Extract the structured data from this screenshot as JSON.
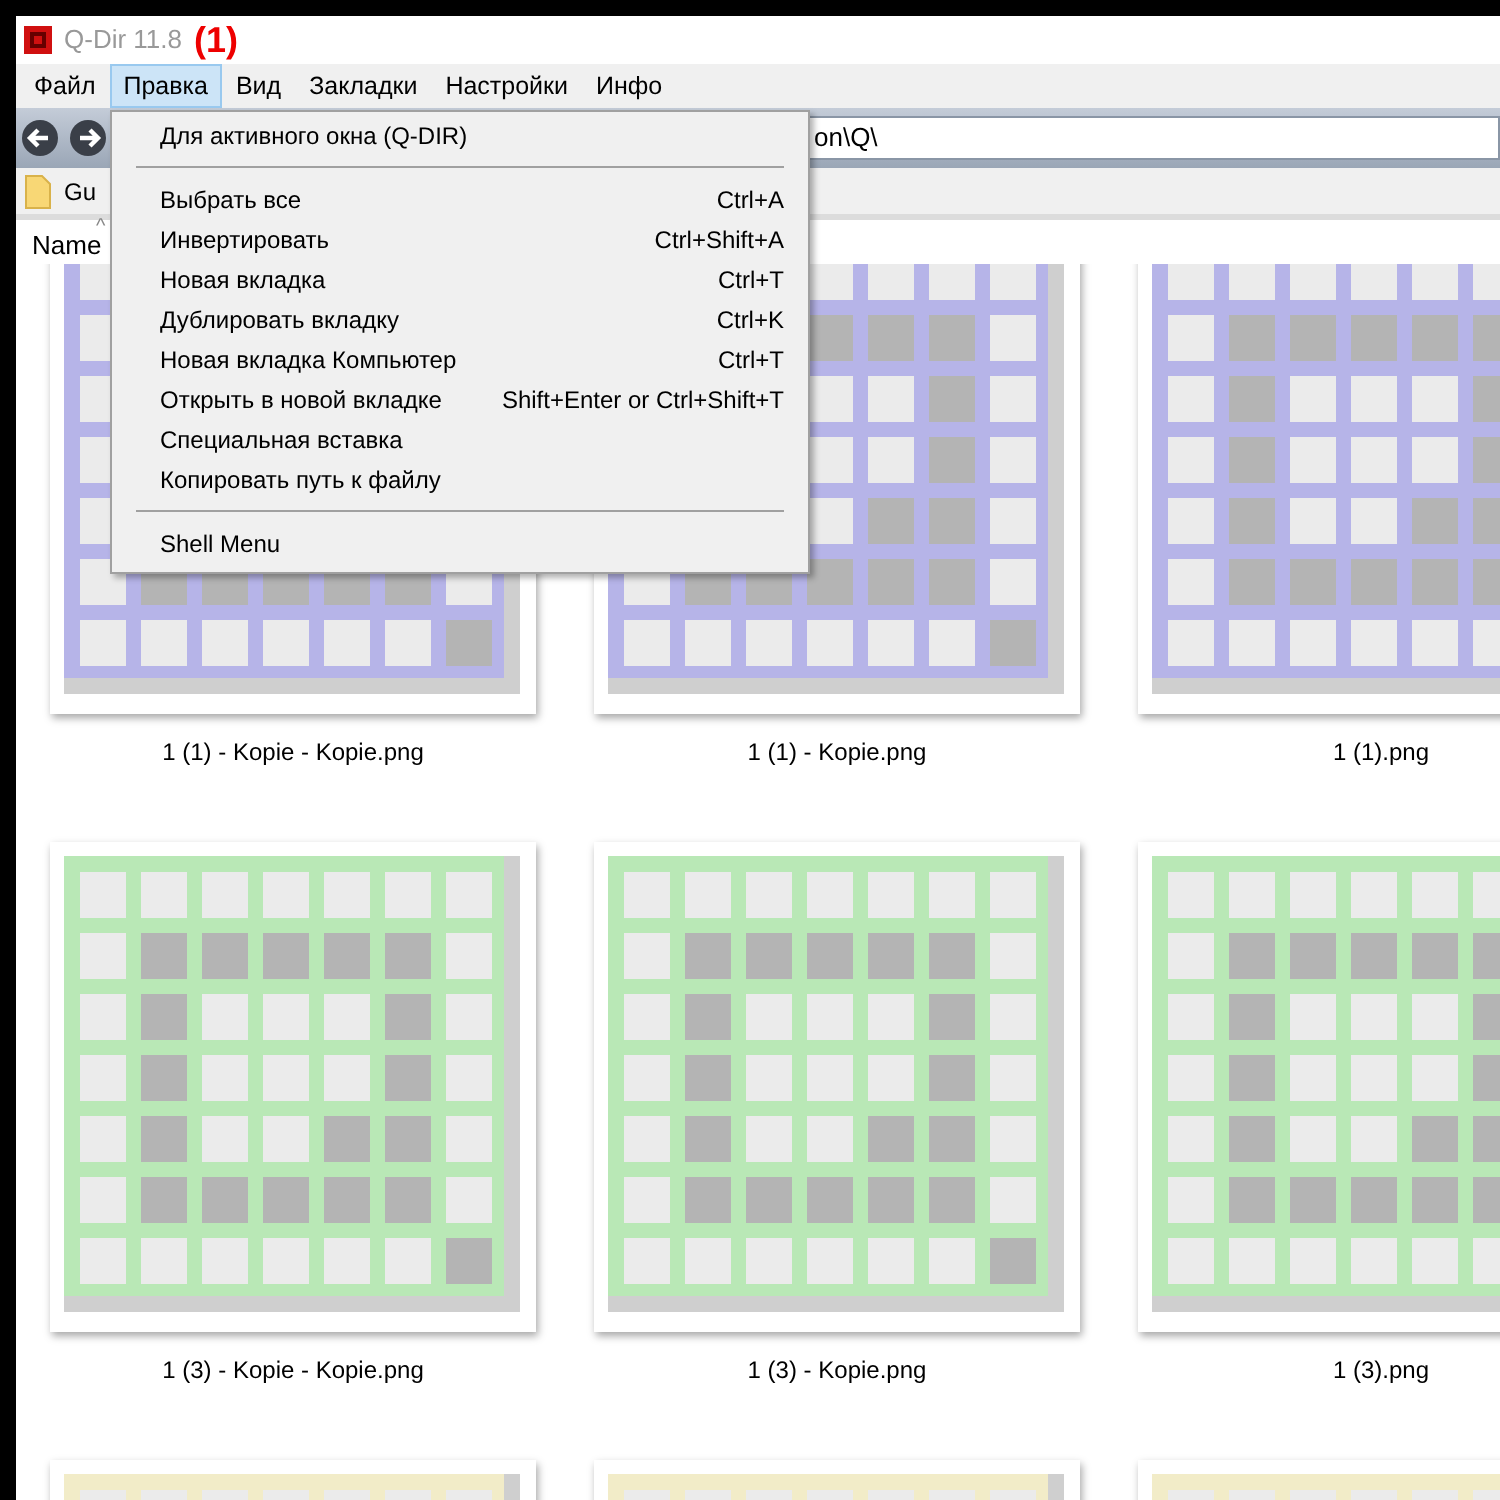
{
  "window": {
    "title": "Q-Dir 11.8",
    "annotation": "(1)"
  },
  "menu_bar": [
    {
      "label": "Файл",
      "selected": false
    },
    {
      "label": "Правка",
      "selected": true
    },
    {
      "label": "Вид",
      "selected": false
    },
    {
      "label": "Закладки",
      "selected": false
    },
    {
      "label": "Настройки",
      "selected": false
    },
    {
      "label": "Инфо",
      "selected": false
    }
  ],
  "address_bar": {
    "value": "on\\Q\\"
  },
  "bookmarks": [
    {
      "label": "Gu"
    }
  ],
  "column_header": {
    "label": "Name",
    "sort_indicator": "^"
  },
  "dropdown_menu": [
    {
      "kind": "item",
      "label": "Для активного окна (Q-DIR)"
    },
    {
      "kind": "separator"
    },
    {
      "kind": "item",
      "label": "Выбрать все",
      "shortcut": "Ctrl+A"
    },
    {
      "kind": "item",
      "label": "Инвертировать",
      "shortcut": "Ctrl+Shift+A"
    },
    {
      "kind": "item",
      "label": "Новая вкладка",
      "shortcut": "Ctrl+T"
    },
    {
      "kind": "item",
      "label": "Дублировать вкладку",
      "shortcut": "Ctrl+K"
    },
    {
      "kind": "item",
      "label": "Новая вкладка Компьютер",
      "shortcut": "Ctrl+T"
    },
    {
      "kind": "item",
      "label": "Открыть в новой вкладке",
      "shortcut": "Shift+Enter or Ctrl+Shift+T"
    },
    {
      "kind": "item",
      "label": "Специальная вставка"
    },
    {
      "kind": "item",
      "label": "Копировать путь к файлу"
    },
    {
      "kind": "separator"
    },
    {
      "kind": "item",
      "label": "Shell Menu"
    }
  ],
  "files": [
    {
      "name": "1 (1) - Kopie - Kopie.png",
      "color": "#b6b4e8"
    },
    {
      "name": "1 (1) - Kopie.png",
      "color": "#b6b4e8"
    },
    {
      "name": "1 (1).png",
      "color": "#b6b4e8"
    },
    {
      "name": "1 (3) - Kopie - Kopie.png",
      "color": "#b9e8b6"
    },
    {
      "name": "1 (3) - Kopie.png",
      "color": "#b9e8b6"
    },
    {
      "name": "1 (3).png",
      "color": "#b9e8b6"
    },
    {
      "color": "#f2ecc8"
    },
    {
      "color": "#f2ecc8"
    },
    {
      "color": "#f2ecc8"
    }
  ]
}
